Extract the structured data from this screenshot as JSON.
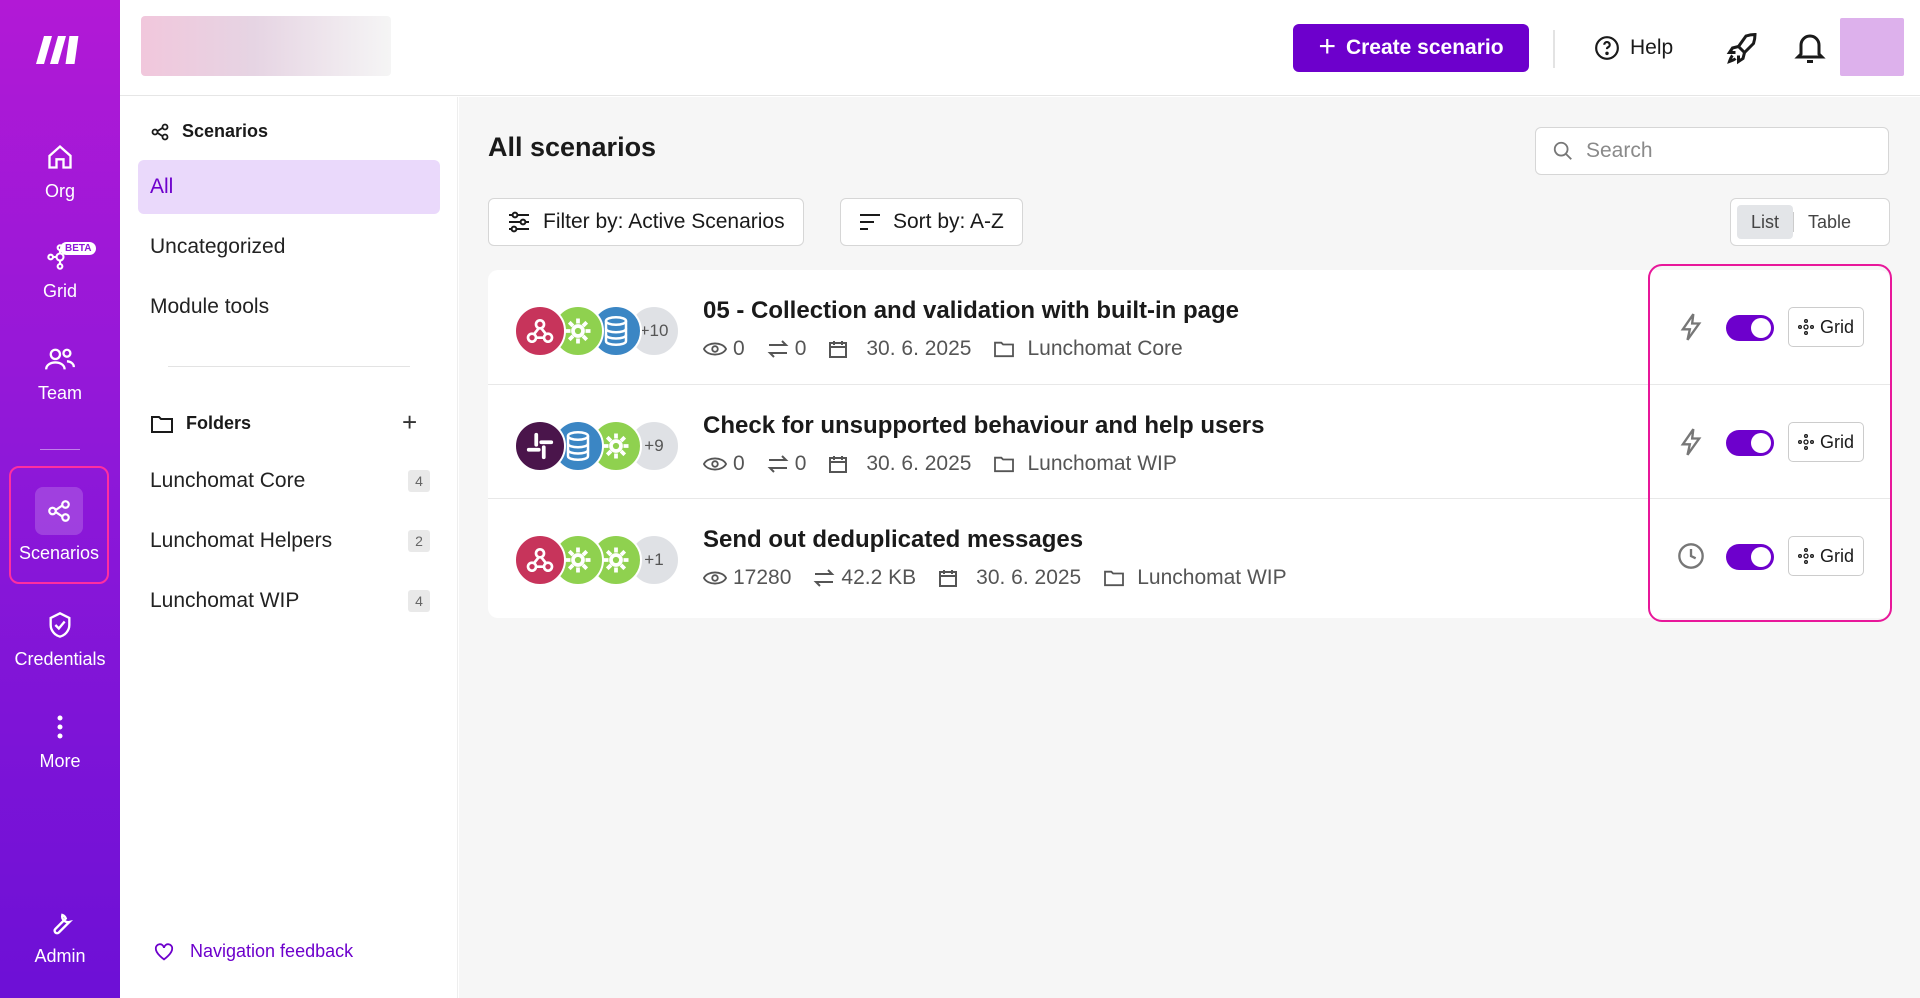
{
  "rail": {
    "items": [
      {
        "label": "Org",
        "icon": "home-icon"
      },
      {
        "label": "Grid",
        "icon": "grid-nodes-icon",
        "badge": "BETA"
      },
      {
        "label": "Team",
        "icon": "team-icon"
      },
      {
        "label": "Scenarios",
        "icon": "scenarios-share-icon",
        "active": true
      },
      {
        "label": "Credentials",
        "icon": "shield-check-icon"
      },
      {
        "label": "More",
        "icon": "more-vertical-icon"
      },
      {
        "label": "Admin",
        "icon": "wrench-icon"
      }
    ]
  },
  "header": {
    "create_label": "Create scenario",
    "help_label": "Help"
  },
  "sidebar": {
    "scenarios_heading": "Scenarios",
    "items": [
      {
        "label": "All",
        "active": true
      },
      {
        "label": "Uncategorized"
      },
      {
        "label": "Module tools"
      }
    ],
    "folders_heading": "Folders",
    "folders": [
      {
        "label": "Lunchomat Core",
        "count": "4"
      },
      {
        "label": "Lunchomat Helpers",
        "count": "2"
      },
      {
        "label": "Lunchomat WIP",
        "count": "4"
      }
    ],
    "feedback_label": "Navigation feedback"
  },
  "main": {
    "title": "All scenarios",
    "search_placeholder": "Search",
    "filter_label": "Filter by: Active Scenarios",
    "sort_label": "Sort by: A-Z",
    "view_list": "List",
    "view_table": "Table"
  },
  "scenarios": [
    {
      "name": "05 - Collection and validation with built-in page",
      "modules": [
        "webhook",
        "tools",
        "datastore"
      ],
      "more": "+10",
      "ops": "0",
      "transfer": "0",
      "date": "30. 6. 2025",
      "folder": "Lunchomat Core",
      "trigger": "instant",
      "grid_label": "Grid"
    },
    {
      "name": "Check for unsupported behaviour and help users",
      "modules": [
        "slack",
        "datastore",
        "tools"
      ],
      "more": "+9",
      "ops": "0",
      "transfer": "0",
      "date": "30. 6. 2025",
      "folder": "Lunchomat WIP",
      "trigger": "instant",
      "grid_label": "Grid"
    },
    {
      "name": "Send out deduplicated messages",
      "modules": [
        "webhook",
        "tools",
        "tools"
      ],
      "more": "+1",
      "ops": "17280",
      "transfer": "42.2 KB",
      "date": "30. 6. 2025",
      "folder": "Lunchomat WIP",
      "trigger": "scheduled",
      "grid_label": "Grid"
    }
  ],
  "colors": {
    "accent": "#6d00cc",
    "highlight": "#e8179a",
    "webhook": "#c7345b",
    "tools": "#8fd14f",
    "datastore": "#3b86c4",
    "slack": "#4a154b"
  }
}
